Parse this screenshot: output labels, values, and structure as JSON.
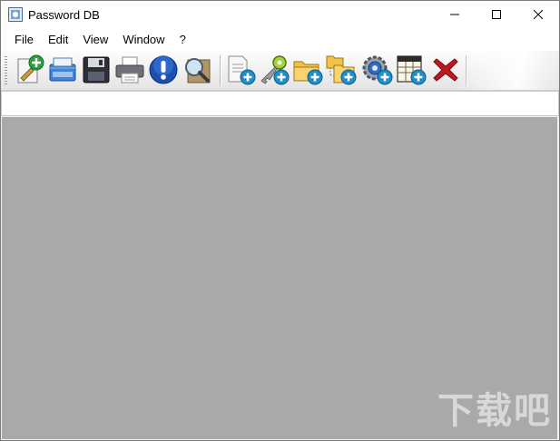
{
  "window": {
    "title": "Password DB",
    "icon": "database-app-icon"
  },
  "controls": [
    "minimize-icon",
    "maximize-icon",
    "close-icon"
  ],
  "menu": [
    {
      "label": "File"
    },
    {
      "label": "Edit"
    },
    {
      "label": "View"
    },
    {
      "label": "Window"
    },
    {
      "label": "?"
    }
  ],
  "toolbar": {
    "buttons": [
      {
        "icon": "new-database-icon",
        "group": 1
      },
      {
        "icon": "open-database-icon",
        "group": 1
      },
      {
        "icon": "save-icon",
        "group": 1
      },
      {
        "icon": "print-icon",
        "group": 1
      },
      {
        "icon": "info-icon",
        "group": 1
      },
      {
        "icon": "search-icon",
        "group": 1
      },
      {
        "icon": "add-entry-icon",
        "group": 2
      },
      {
        "icon": "add-key-icon",
        "group": 2
      },
      {
        "icon": "add-folder-icon",
        "group": 2
      },
      {
        "icon": "add-subfolder-icon",
        "group": 2
      },
      {
        "icon": "add-settings-icon",
        "group": 2
      },
      {
        "icon": "add-table-icon",
        "group": 2
      },
      {
        "icon": "delete-icon",
        "group": 2
      }
    ]
  },
  "colors": {
    "workspace": "#a9a9a9",
    "plus_badge": "#1f8fc7",
    "delete_red": "#c0181c"
  },
  "watermark": {
    "text": "下载吧"
  }
}
